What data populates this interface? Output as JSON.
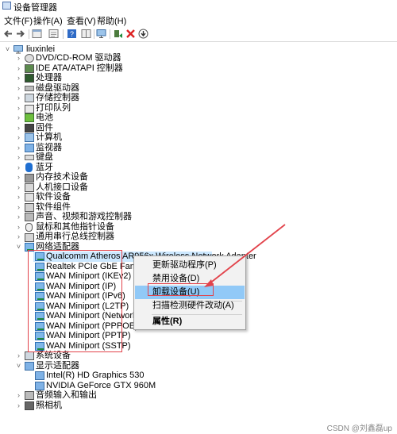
{
  "window": {
    "title": "设备管理器"
  },
  "menu": [
    "文件(F)",
    "操作(A)",
    "查看(V)",
    "帮助(H)"
  ],
  "toolbar": [
    "back-icon",
    "forward-icon",
    "properties-icon",
    "show-hidden-icon",
    "help-icon",
    "computer-icon",
    "scan-icon",
    "uninstall-x-icon",
    "update-driver-icon"
  ],
  "tree": {
    "root": "liuxinlei",
    "categories": [
      {
        "label": "DVD/CD-ROM 驱动器",
        "icon": "dvd-icon"
      },
      {
        "label": "IDE ATA/ATAPI 控制器",
        "icon": "ide-controller-icon"
      },
      {
        "label": "处理器",
        "icon": "cpu-icon"
      },
      {
        "label": "磁盘驱动器",
        "icon": "disk-icon"
      },
      {
        "label": "存储控制器",
        "icon": "storage-controller-icon"
      },
      {
        "label": "打印队列",
        "icon": "printer-icon"
      },
      {
        "label": "电池",
        "icon": "battery-icon"
      },
      {
        "label": "固件",
        "icon": "firmware-icon"
      },
      {
        "label": "计算机",
        "icon": "computer-icon"
      },
      {
        "label": "监视器",
        "icon": "monitor-icon"
      },
      {
        "label": "键盘",
        "icon": "keyboard-icon"
      },
      {
        "label": "蓝牙",
        "icon": "bluetooth-icon"
      },
      {
        "label": "内存技术设备",
        "icon": "memory-icon"
      },
      {
        "label": "人机接口设备",
        "icon": "hid-icon"
      },
      {
        "label": "软件设备",
        "icon": "software-device-icon"
      },
      {
        "label": "软件组件",
        "icon": "software-component-icon"
      },
      {
        "label": "声音、视频和游戏控制器",
        "icon": "sound-icon"
      },
      {
        "label": "鼠标和其他指针设备",
        "icon": "mouse-icon"
      },
      {
        "label": "通用串行总线控制器",
        "icon": "usb-icon"
      }
    ],
    "network": {
      "label": "网络适配器",
      "items": [
        "Qualcomm Atheros AR956x Wireless Network Adapter",
        "Realtek PCIe GbE Family Con",
        "WAN Miniport (IKEv2)",
        "WAN Miniport (IP)",
        "WAN Miniport (IPv6)",
        "WAN Miniport (L2TP)",
        "WAN Miniport (Network Mor",
        "WAN Miniport (PPPOE)",
        "WAN Miniport (PPTP)",
        "WAN Miniport (SSTP)"
      ]
    },
    "after": [
      {
        "label": "系统设备",
        "icon": "system-device-icon",
        "expanded": false
      },
      {
        "label": "显示适配器",
        "icon": "display-adapter-icon",
        "expanded": true,
        "children": [
          "Intel(R) HD Graphics 530",
          "NVIDIA GeForce GTX 960M"
        ]
      },
      {
        "label": "音频输入和输出",
        "icon": "audio-io-icon",
        "expanded": false
      },
      {
        "label": "照相机",
        "icon": "camera-icon",
        "expanded": false
      }
    ]
  },
  "context_menu": {
    "items": [
      "更新驱动程序(P)",
      "禁用设备(D)",
      "卸载设备(U)",
      "扫描检测硬件改动(A)",
      "属性(R)"
    ],
    "highlighted": "卸载设备(U)"
  },
  "watermark": "CSDN @刘鑫磊up",
  "colors": {
    "selection": "#cce8ff",
    "menu_highlight": "#91c9f7",
    "annotation": "#e2434b"
  }
}
